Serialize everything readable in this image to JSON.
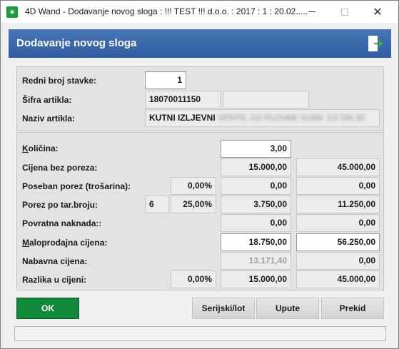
{
  "window": {
    "title": "4D Wand - Dodavanje novog sloga : !!! TEST !!! d.o.o. : 2017 : 1 : 20.02.....",
    "app_icon": "✶",
    "close_glyph": "✕"
  },
  "header": {
    "title": "Dodavanje novog sloga",
    "accent_color": "#3a68ab"
  },
  "form": {
    "redni_broj": {
      "label": "Redni broj stavke:",
      "value": "1"
    },
    "sifra": {
      "label": "Šifra artikla:",
      "value": "18070011150",
      "extra": ""
    },
    "naziv": {
      "label": "Naziv artikla:",
      "value": "KUTNI IZLJEVNI",
      "value_hidden": "VENTIL 1/2 PLOVAK VIJAK 1/2 DN 20"
    },
    "kolicina": {
      "label": "Količina:",
      "value": "3,00"
    },
    "cijena_bez_poreza": {
      "label": "Cijena bez poreza:",
      "unit": "15.000,00",
      "total": "45.000,00"
    },
    "poseban_porez": {
      "label": "Poseban porez (trošarina):",
      "percent": "0,00%",
      "unit": "0,00",
      "total": "0,00"
    },
    "porez": {
      "label": "Porez po tar.broju:",
      "code": "6",
      "percent": "25,00%",
      "unit": "3.750,00",
      "total": "11.250,00"
    },
    "povratna": {
      "label": "Povratna naknada::",
      "unit": "0,00",
      "total": "0,00"
    },
    "maloprodajna": {
      "label": "Maloprodajna cijena:",
      "unit": "18.750,00",
      "total": "56.250,00"
    },
    "nabavna": {
      "label": "Nabavna cijena:",
      "unit": "13.171,40",
      "total": "0,00"
    },
    "razlika": {
      "label": "Razlika u cijeni:",
      "percent": "0,00%",
      "unit": "15.000,00",
      "total": "45.000,00"
    }
  },
  "buttons": {
    "ok": "OK",
    "serijski": "Serijski/lot",
    "upute": "Upute",
    "prekid": "Prekid",
    "ok_color": "#118a3b"
  },
  "status": {
    "text": ""
  }
}
